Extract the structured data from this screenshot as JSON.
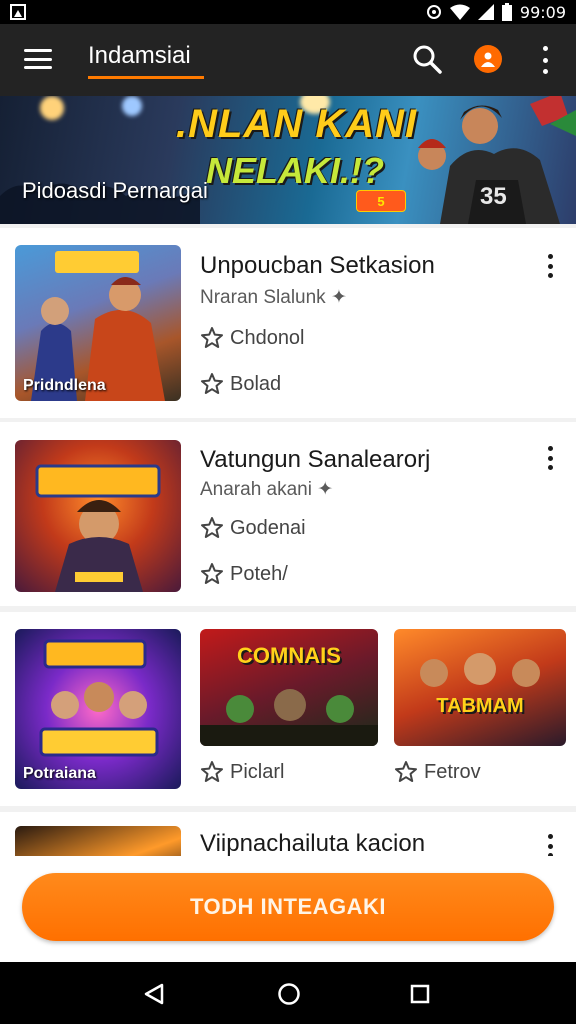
{
  "status_bar": {
    "time": "99:09",
    "icons": [
      "notification-icon",
      "sync-icon",
      "wifi-icon",
      "signal-icon",
      "battery-icon"
    ]
  },
  "app_bar": {
    "title": "Indamsiai",
    "icons": [
      "menu-icon",
      "search-icon",
      "avatar-icon",
      "overflow-icon"
    ]
  },
  "banner": {
    "headline_line1": ".NLAN KANI",
    "headline_line2": "NELAKI.!?",
    "subtitle": "Pidoasdi Pernargai",
    "badge": "5"
  },
  "items": [
    {
      "thumb_label": "Pridndlena",
      "title": "Unpoucban Setkasion",
      "subtitle": "Nraran Slalunk",
      "meta1": "Chdonol",
      "meta2": "Bolad"
    },
    {
      "thumb_label": "",
      "title": "Vatungun Sanalearorj",
      "subtitle": "Anarah akani",
      "meta1": "Godenai",
      "meta2": "Poteh/"
    },
    {
      "thumb_label": "Potraiana",
      "thumbs": [
        "COMNAIS",
        "TABMAM"
      ],
      "meta1": "Piclarl",
      "meta2": "Fetrov"
    },
    {
      "title": "Viipnachailuta kacion"
    }
  ],
  "cta": {
    "label": "TODH INTEAGAKI"
  },
  "colors": {
    "accent": "#ff7a00",
    "app_bar": "#232323",
    "card_bg": "#ffffff"
  }
}
